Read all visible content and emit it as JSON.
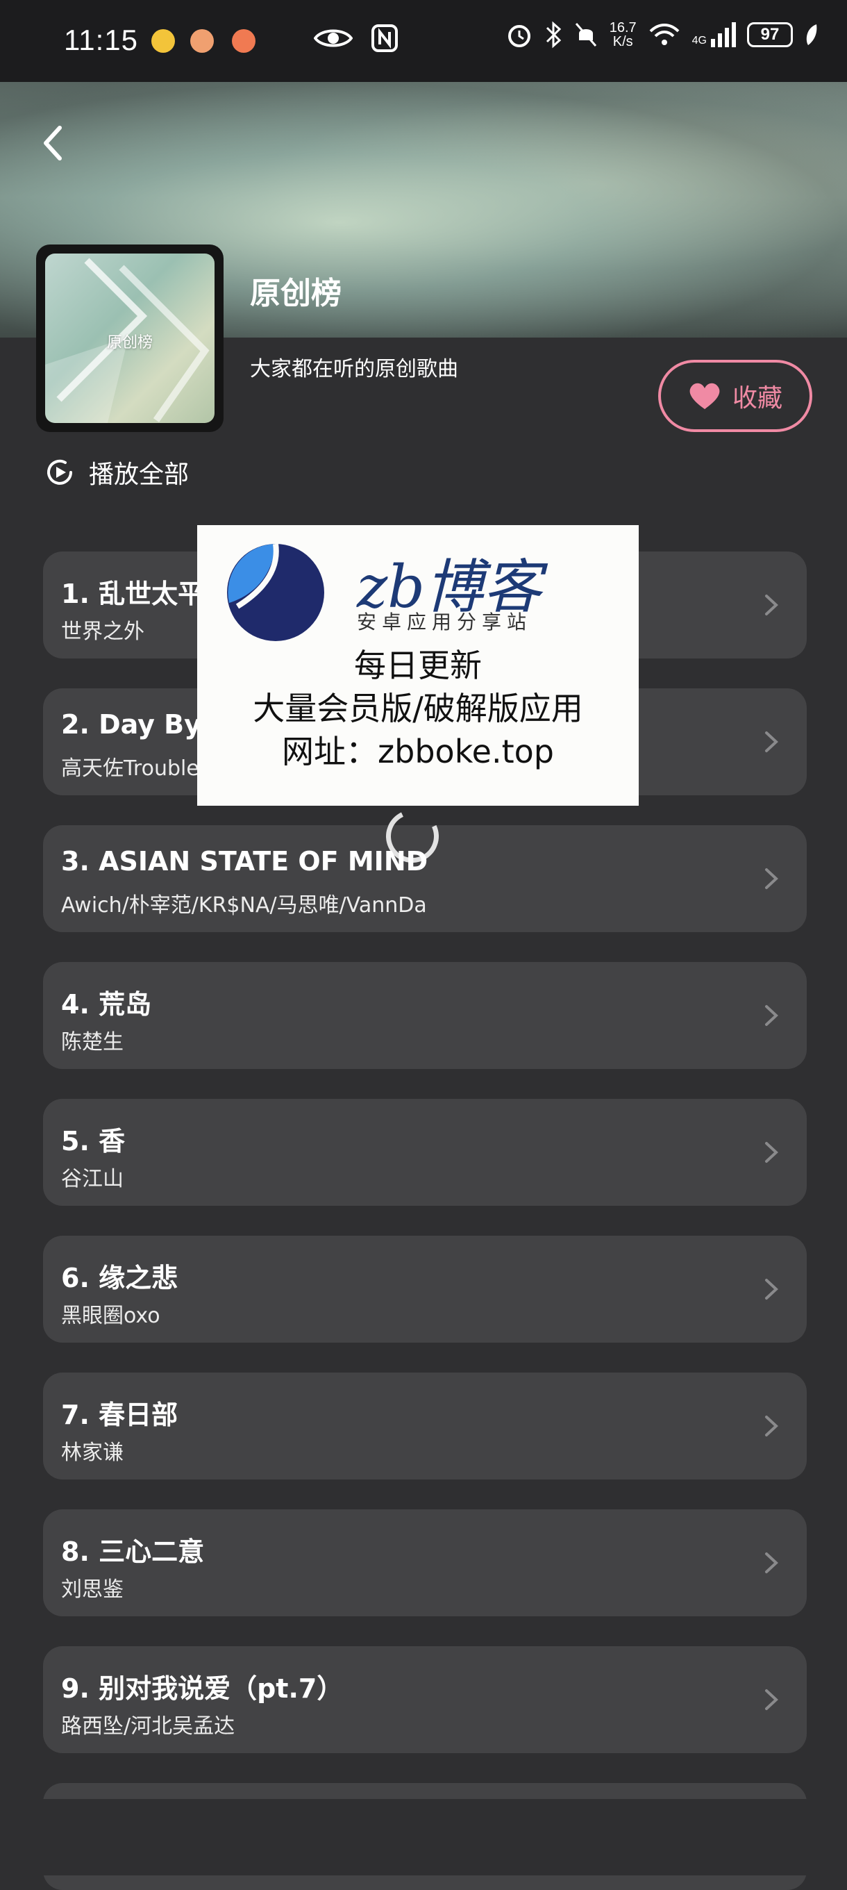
{
  "status_bar": {
    "time": "11:15",
    "network_speed": "16.7",
    "network_speed_unit": "K/s",
    "signal_type": "4G",
    "battery": "97"
  },
  "header": {
    "cover_label": "原创榜",
    "title": "原创榜",
    "subtitle": "大家都在听的原创歌曲",
    "collect_label": "收藏",
    "play_all_label": "播放全部"
  },
  "songs": [
    {
      "title": "1. 乱世太平",
      "artist": "世界之外"
    },
    {
      "title": "2. Day By Day",
      "artist": "高天佐Trouble"
    },
    {
      "title": "3. ASIAN STATE OF MIND",
      "artist": "Awich/朴宰范/KR$NA/马思唯/VannDa"
    },
    {
      "title": "4. 荒岛",
      "artist": "陈楚生"
    },
    {
      "title": "5. 香",
      "artist": "谷江山"
    },
    {
      "title": "6. 缘之悲",
      "artist": "黑眼圈oxo"
    },
    {
      "title": "7. 春日部",
      "artist": "林家谦"
    },
    {
      "title": "8. 三心二意",
      "artist": "刘思鉴"
    },
    {
      "title": "9. 别对我说爱（pt.7）",
      "artist": "路西坠/河北吴孟达"
    }
  ],
  "watermark": {
    "brand": "zb博客",
    "tagline": "安卓应用分享站",
    "line1": "每日更新",
    "line2": "大量会员版/破解版应用",
    "line3": "网址：zbboke.top"
  },
  "colors": {
    "background": "#2f2f31",
    "row_background": "#434345",
    "accent_pink": "#f08aa4"
  }
}
